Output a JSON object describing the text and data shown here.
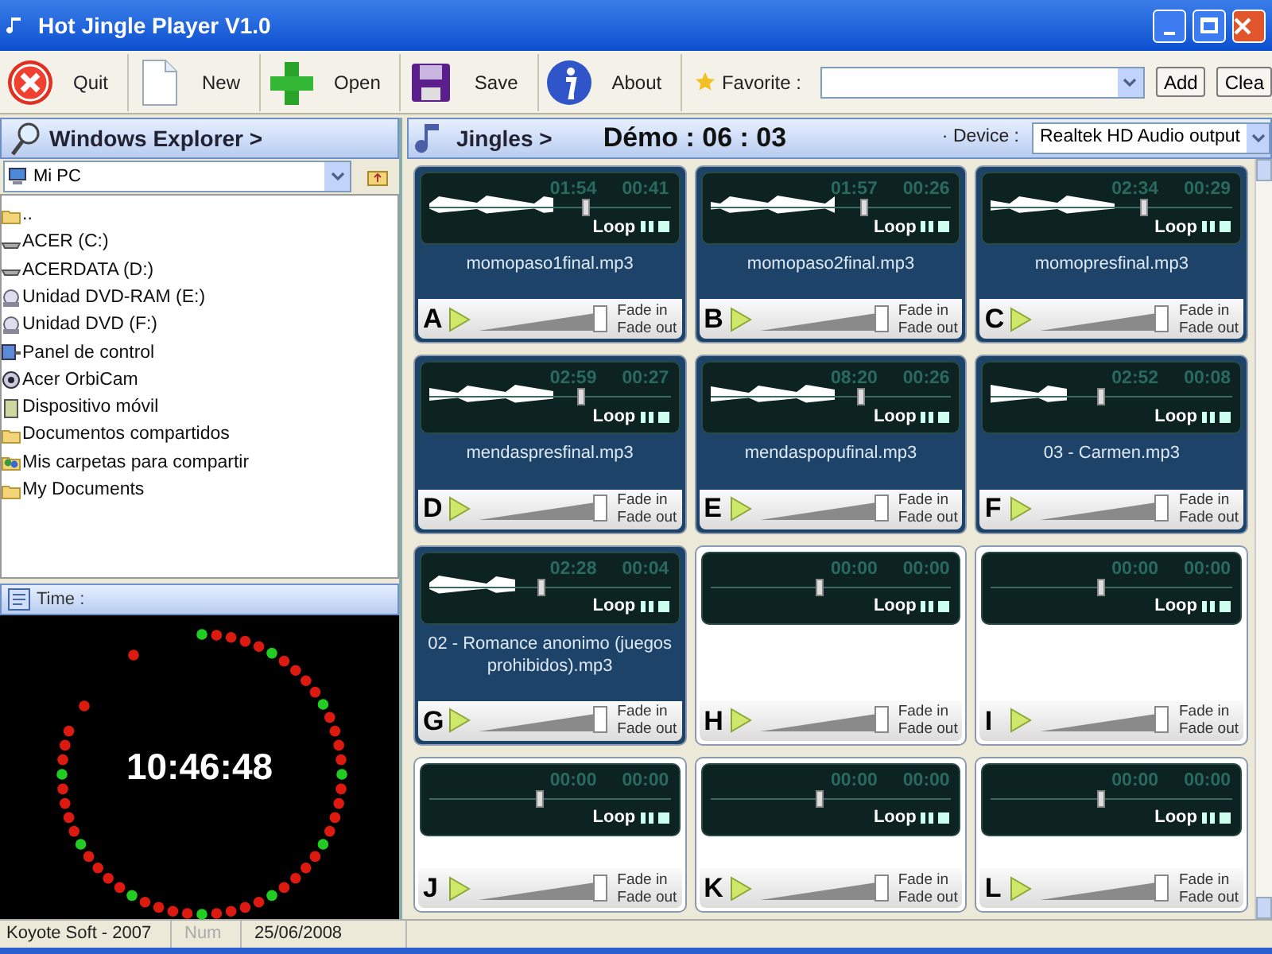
{
  "window": {
    "title": "Hot Jingle Player V1.0"
  },
  "toolbar": [
    {
      "label": "Quit",
      "kind": "quit"
    },
    {
      "label": "New",
      "kind": "new"
    },
    {
      "label": "Open",
      "kind": "open"
    },
    {
      "label": "Save",
      "kind": "save"
    },
    {
      "label": "About",
      "kind": "about"
    }
  ],
  "favorite": {
    "label": "Favorite :",
    "buttons": [
      "Add",
      "Clea"
    ]
  },
  "explorer": {
    "title": "Windows Explorer >",
    "location": "Mi PC",
    "items": [
      {
        "label": "..",
        "kind": "folder"
      },
      {
        "label": "ACER (C:)",
        "kind": "drive"
      },
      {
        "label": "ACERDATA (D:)",
        "kind": "drive"
      },
      {
        "label": "Unidad DVD-RAM (E:)",
        "kind": "disc"
      },
      {
        "label": "Unidad DVD (F:)",
        "kind": "disc"
      },
      {
        "label": "Panel de control",
        "kind": "control"
      },
      {
        "label": "Acer OrbiCam",
        "kind": "camera"
      },
      {
        "label": "Dispositivo móvil",
        "kind": "device"
      },
      {
        "label": "Documentos compartidos",
        "kind": "folder"
      },
      {
        "label": "Mis carpetas para compartir",
        "kind": "shared"
      },
      {
        "label": "My Documents",
        "kind": "folder"
      }
    ]
  },
  "time_panel": {
    "title": "Time :",
    "clock": "10:46:48"
  },
  "jingles": {
    "title": "Jingles >",
    "demo": "Démo : 06 : 03",
    "device_label": "· Device :",
    "device": "Realtek HD Audio output",
    "pads": [
      {
        "key": "A",
        "file": "momopaso1final.mp3",
        "elapsed": "01:54",
        "remaining": "00:41",
        "loaded": true,
        "level": 0.63,
        "volume": {
          "level": 0.95
        },
        "loop": "Loop",
        "fade_in": "Fade in",
        "fade_out": "Fade out"
      },
      {
        "key": "B",
        "file": "momopaso2final.mp3",
        "elapsed": "01:57",
        "remaining": "00:26",
        "loaded": true,
        "level": 0.62,
        "volume": {
          "level": 0.95
        },
        "loop": "Loop",
        "fade_in": "Fade in",
        "fade_out": "Fade out"
      },
      {
        "key": "C",
        "file": "momopresfinal.mp3",
        "elapsed": "02:34",
        "remaining": "00:29",
        "loaded": true,
        "level": 0.62,
        "volume": {
          "level": 0.95
        },
        "loop": "Loop",
        "fade_in": "Fade in",
        "fade_out": "Fade out"
      },
      {
        "key": "D",
        "file": "mendaspresfinal.mp3",
        "elapsed": "02:59",
        "remaining": "00:27",
        "loaded": true,
        "level": 0.61,
        "volume": {
          "level": 0.95
        },
        "loop": "Loop",
        "fade_in": "Fade in",
        "fade_out": "Fade out"
      },
      {
        "key": "E",
        "file": "mendaspopufinal.mp3",
        "elapsed": "08:20",
        "remaining": "00:26",
        "loaded": true,
        "level": 0.61,
        "volume": {
          "level": 0.95
        },
        "loop": "Loop",
        "fade_in": "Fade in",
        "fade_out": "Fade out"
      },
      {
        "key": "F",
        "file": "03 - Carmen.mp3",
        "elapsed": "02:52",
        "remaining": "00:08",
        "loaded": true,
        "level": 0.44,
        "volume": {
          "level": 0.95
        },
        "loop": "Loop",
        "fade_in": "Fade in",
        "fade_out": "Fade out"
      },
      {
        "key": "G",
        "file": "02 - Romance anonimo (juegos prohibidos).mp3",
        "elapsed": "02:28",
        "remaining": "00:04",
        "loaded": true,
        "level": 0.45,
        "volume": {
          "level": 0.95
        },
        "loop": "Loop",
        "fade_in": "Fade in",
        "fade_out": "Fade out"
      },
      {
        "key": "H",
        "elapsed": "00:00",
        "remaining": "00:00",
        "loaded": false,
        "level": 0.44,
        "volume": {
          "level": 0.95
        },
        "loop": "Loop",
        "fade_in": "Fade in",
        "fade_out": "Fade out"
      },
      {
        "key": "I",
        "elapsed": "00:00",
        "remaining": "00:00",
        "loaded": false,
        "level": 0.44,
        "volume": {
          "level": 0.95
        },
        "loop": "Loop",
        "fade_in": "Fade in",
        "fade_out": "Fade out"
      },
      {
        "key": "J",
        "elapsed": "00:00",
        "remaining": "00:00",
        "loaded": false,
        "level": 0.44,
        "volume": {
          "level": 0.95
        },
        "loop": "Loop",
        "fade_in": "Fade in",
        "fade_out": "Fade out"
      },
      {
        "key": "K",
        "elapsed": "00:00",
        "remaining": "00:00",
        "loaded": false,
        "level": 0.44,
        "volume": {
          "level": 0.95
        },
        "loop": "Loop",
        "fade_in": "Fade in",
        "fade_out": "Fade out"
      },
      {
        "key": "L",
        "elapsed": "00:00",
        "remaining": "00:00",
        "loaded": false,
        "level": 0.44,
        "volume": {
          "level": 0.95
        },
        "loop": "Loop",
        "fade_in": "Fade in",
        "fade_out": "Fade out"
      }
    ]
  },
  "status_bar": [
    {
      "text": "Koyote Soft - 2007",
      "disabled": false
    },
    {
      "text": "Num",
      "disabled": true
    },
    {
      "text": "25/06/2008",
      "disabled": false
    }
  ]
}
